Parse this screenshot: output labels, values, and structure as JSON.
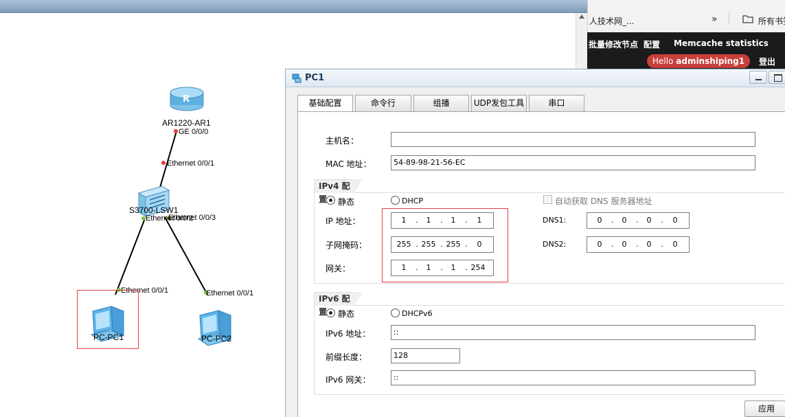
{
  "topology": {
    "devices": {
      "router": "AR1220-AR1",
      "switch": "S3700-LSW1",
      "pc1": "PC-PC1",
      "pc2": "PC-PC2"
    },
    "ports": {
      "router_port": "GE 0/0/0",
      "switch_uplink": "Ethernet 0/0/1",
      "switch_port2": "Ethernet 0/0/2",
      "switch_port3": "Ethernet 0/0/3",
      "pc1_port": "Ethernet 0/0/1",
      "pc2_port": "Ethernet 0/0/1"
    },
    "colors": {
      "link": "#000000",
      "port_down": "#e53b3b",
      "port_up": "#7ec13a",
      "highlight": "#e04040"
    }
  },
  "browser": {
    "bookmark_1": "人技术网_...",
    "overflow_glyph": "»",
    "bookmark_folder": "所有书签",
    "nav": [
      "批量修改节点",
      "配置",
      "Memcache statistics"
    ],
    "hello_prefix": "Hello",
    "hello_user": "adminshiping1",
    "logout": "登出"
  },
  "dialog": {
    "title": "PC1",
    "tabs": [
      "基础配置",
      "命令行",
      "组播",
      "UDP发包工具",
      "串口"
    ],
    "active_tab": 0,
    "hostname_label": "主机名：",
    "hostname_value": "",
    "mac_label": "MAC 地址：",
    "mac_value": "54-89-98-21-56-EC",
    "ipv4": {
      "title": "IPv4 配置",
      "static_label": "静态",
      "dhcp_label": "DHCP",
      "mode": "static",
      "auto_dns_label": "自动获取 DNS 服务器地址",
      "ip_label": "IP 地址：",
      "ip": [
        "1",
        "1",
        "1",
        "1"
      ],
      "mask_label": "子网掩码：",
      "mask": [
        "255",
        "255",
        "255",
        "0"
      ],
      "gateway_label": "网关：",
      "gateway": [
        "1",
        "1",
        "1",
        "254"
      ],
      "dns1_label": "DNS1:",
      "dns1": [
        "0",
        "0",
        "0",
        "0"
      ],
      "dns2_label": "DNS2:",
      "dns2": [
        "0",
        "0",
        "0",
        "0"
      ]
    },
    "ipv6": {
      "title": "IPv6 配置",
      "static_label": "静态",
      "dhcp_label": "DHCPv6",
      "mode": "static",
      "addr_label": "IPv6 地址：",
      "addr_value": "::",
      "prefix_label": "前缀长度：",
      "prefix_value": "128",
      "gateway_label": "IPv6 网关：",
      "gateway_value": "::"
    },
    "apply_label": "应用"
  }
}
